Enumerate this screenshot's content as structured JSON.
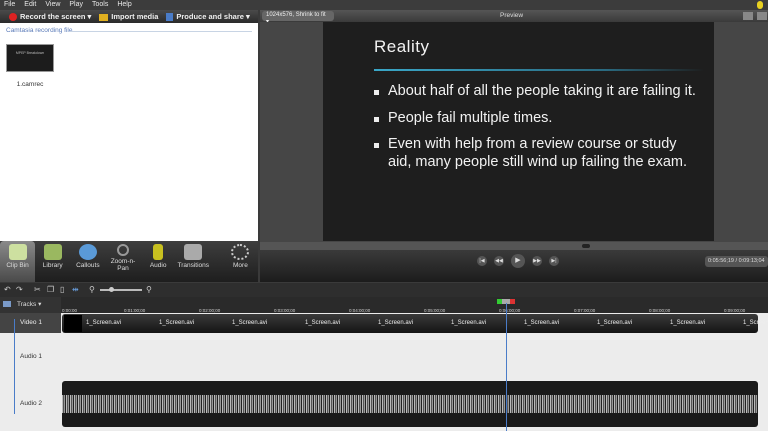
{
  "menu": [
    "File",
    "Edit",
    "View",
    "Play",
    "Tools",
    "Help"
  ],
  "toolbar": {
    "record": "Record the screen ▾",
    "import": "Import media",
    "produce": "Produce and share ▾"
  },
  "clip_bin": {
    "section": "Camtasia recording file",
    "thumb_text": "MPEP Breakdown",
    "file": "1.camrec"
  },
  "tabs": [
    {
      "label": "Clip Bin",
      "icon": "clip-bin-icon",
      "active": true
    },
    {
      "label": "Library",
      "icon": "folder-icon"
    },
    {
      "label": "Callouts",
      "icon": "speech-bubble-icon"
    },
    {
      "label": "Zoom-n-Pan",
      "icon": "magnifier-icon"
    },
    {
      "label": "Audio",
      "icon": "speaker-icon"
    },
    {
      "label": "Transitions",
      "icon": "transitions-icon"
    },
    {
      "label": "More",
      "icon": "dots-icon"
    }
  ],
  "preview": {
    "size": "1024x576, Shrink to fit ▾",
    "label": "Preview",
    "time": "0:05:56;19 / 0:09:13;04"
  },
  "slide": {
    "title": "Reality",
    "bullets": [
      "About half of all the people taking it are failing it.",
      "People fail multiple times.",
      "Even with help from a review course or study aid, many people still wind up failing the exam."
    ]
  },
  "timeline": {
    "tracks_label": "Tracks ▾",
    "ruler": [
      "0:00:00",
      "0:01:00;00",
      "0:02:00;00",
      "0:03:00;00",
      "0:04:00;00",
      "0:05:00;00",
      "0:06:00;00",
      "0:07:00;00",
      "0:08:00;00",
      "0:09:00;00"
    ],
    "tracks": [
      "Video 1",
      "Audio 1",
      "Audio 2"
    ],
    "clip_name": "1_Screen.avi",
    "clip_count": 10
  }
}
